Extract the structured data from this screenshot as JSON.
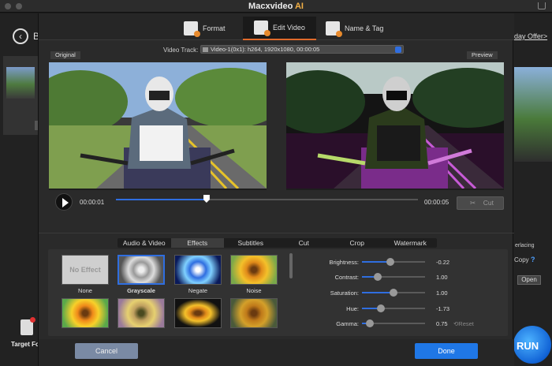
{
  "app": {
    "title_main": "Macxvideo",
    "title_accent": "AI"
  },
  "background": {
    "back_letter": "B",
    "holiday_link": "iday Offer>",
    "deinterlacing_text": "erlacing",
    "copy_text": "Copy",
    "open_label": "Open",
    "run_label": "RUN",
    "target_label": "Target Fo"
  },
  "tabs": [
    {
      "label": "Format"
    },
    {
      "label": "Edit Video"
    },
    {
      "label": "Name & Tag"
    }
  ],
  "video_track": {
    "label": "Video Track:",
    "value": "Video-1(0x1): h264, 1920x1080, 00:00:05"
  },
  "preview": {
    "original_label": "Original",
    "preview_label": "Preview"
  },
  "playback": {
    "current_time": "00:00:01",
    "end_time": "00:00:05",
    "progress": 0.3,
    "cut_label": "Cut"
  },
  "sub_tabs": [
    "Audio & Video",
    "Effects",
    "Subtitles",
    "Cut",
    "Crop",
    "Watermark"
  ],
  "active_sub_tab": "Effects",
  "effects": [
    {
      "name": "None",
      "thumb_text": "No Effect"
    },
    {
      "name": "Grayscale"
    },
    {
      "name": "Negate"
    },
    {
      "name": "Noise"
    },
    {
      "name": ""
    },
    {
      "name": ""
    },
    {
      "name": ""
    },
    {
      "name": ""
    }
  ],
  "adjustments": [
    {
      "label": "Brightness:",
      "value": "-0.22",
      "level": 0.45
    },
    {
      "label": "Contrast:",
      "value": "1.00",
      "level": 0.25
    },
    {
      "label": "Saturation:",
      "value": "1.00",
      "level": 0.5
    },
    {
      "label": "Hue:",
      "value": "-1.73",
      "level": 0.3
    },
    {
      "label": "Gamma:",
      "value": "0.75",
      "level": 0.12
    }
  ],
  "reset_label": "Reset",
  "buttons": {
    "cancel": "Cancel",
    "done": "Done"
  },
  "colors": {
    "accent_blue": "#1f77e6",
    "tab_underline": "#e06a2b",
    "title_accent": "#f3b045"
  }
}
